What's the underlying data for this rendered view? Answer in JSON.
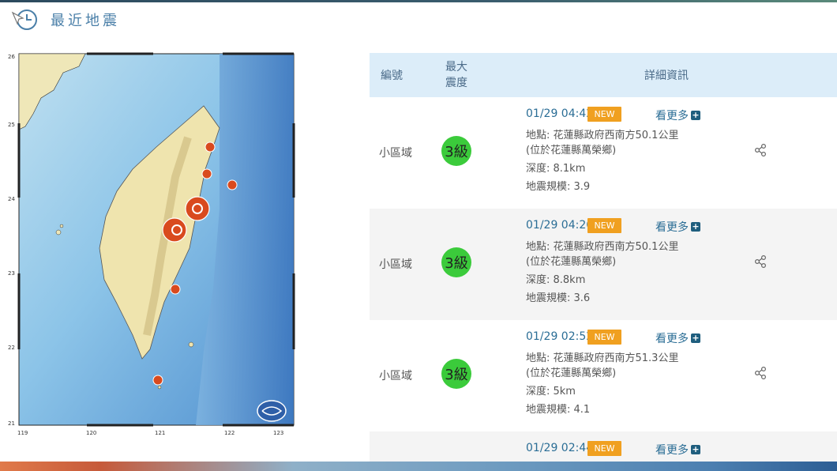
{
  "header": {
    "title": "最近地震",
    "icon": "clock-icon"
  },
  "map": {
    "lat_labels": [
      "26",
      "25",
      "24",
      "23",
      "22",
      "21"
    ],
    "lon_labels": [
      "119",
      "120",
      "121",
      "122",
      "123"
    ],
    "logo": "cwb-logo"
  },
  "table": {
    "headers": {
      "id": "編號",
      "intensity_line1": "最大",
      "intensity_line2": "震度",
      "detail": "詳細資訊"
    },
    "rows": [
      {
        "region": "小區域",
        "intensity": "3級",
        "time": "01/29 04:42",
        "new": "NEW",
        "more": "看更多",
        "location": "地點: 花蓮縣政府西南方50.1公里",
        "location2": "(位於花蓮縣萬榮鄉)",
        "depth": "深度: 8.1km",
        "magnitude": "地震規模: 3.9"
      },
      {
        "region": "小區域",
        "intensity": "3級",
        "time": "01/29 04:26",
        "new": "NEW",
        "more": "看更多",
        "location": "地點: 花蓮縣政府西南方50.1公里",
        "location2": "(位於花蓮縣萬榮鄉)",
        "depth": "深度: 8.8km",
        "magnitude": "地震規模: 3.6"
      },
      {
        "region": "小區域",
        "intensity": "3級",
        "time": "01/29 02:52",
        "new": "NEW",
        "more": "看更多",
        "location": "地點: 花蓮縣政府西南方51.3公里",
        "location2": "(位於花蓮縣萬榮鄉)",
        "depth": "深度: 5km",
        "magnitude": "地震規模: 4.1"
      },
      {
        "time": "01/29 02:44",
        "new": "NEW",
        "more": "看更多"
      }
    ]
  },
  "colors": {
    "accent": "#2a6d95",
    "new_badge": "#f0a020",
    "intensity_green": "#3bcb3b",
    "header_bg": "#dcedf9"
  }
}
